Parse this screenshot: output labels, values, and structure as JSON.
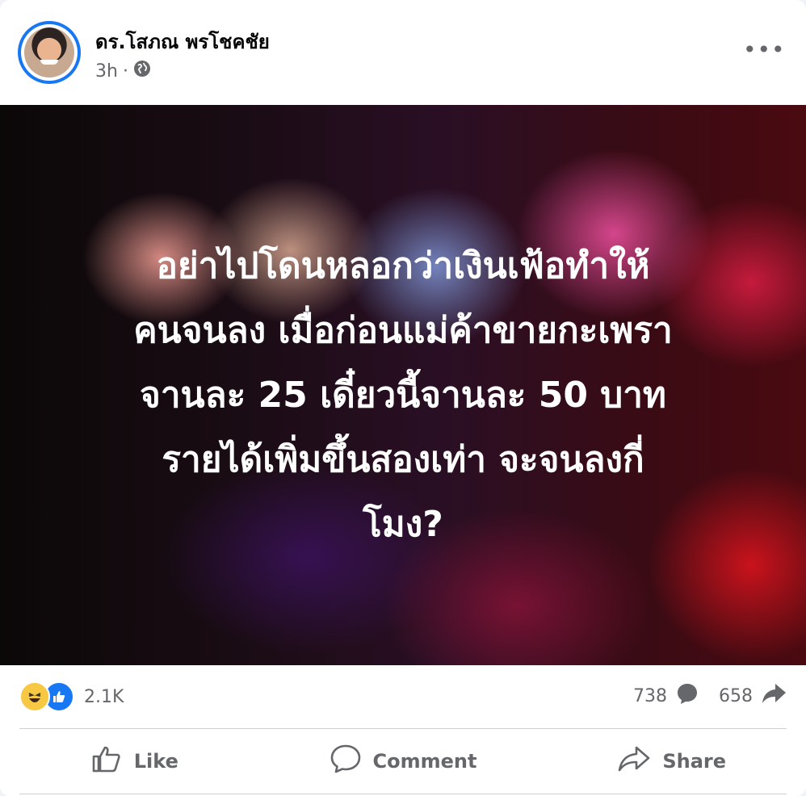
{
  "post": {
    "author": "ดร.โสภณ พรโชคชัย",
    "time": "3h",
    "privacy_icon": "globe-icon",
    "more_label": "•••"
  },
  "image": {
    "lines": [
      "อย่าไปโดนหลอกว่าเงินเฟ้อทำให้",
      "คนจนลง เมื่อก่อนแม่ค้าขายกะเพรา",
      "จานละ 25 เดี๋ยวนี้จานละ 50 บาท",
      "รายได้เพิ่มขึ้นสองเท่า จะจนลงกี่",
      "โมง?"
    ]
  },
  "stats": {
    "reaction_count": "2.1K",
    "comment_count": "738",
    "share_count": "658"
  },
  "actions": {
    "like": "Like",
    "comment": "Comment",
    "share": "Share"
  },
  "colors": {
    "accent": "#1877f2",
    "muted": "#65676b",
    "divider": "#ced0d4"
  }
}
